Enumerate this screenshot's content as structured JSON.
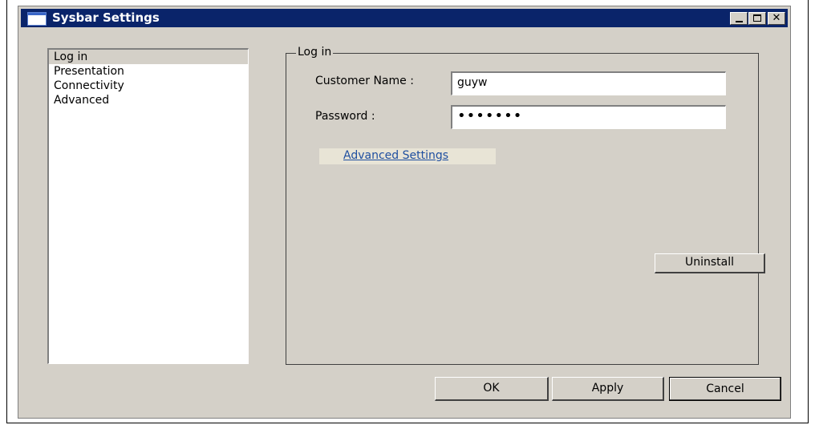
{
  "window": {
    "title": "Sysbar Settings"
  },
  "nav": {
    "items": [
      "Log in",
      "Presentation",
      "Connectivity",
      "Advanced"
    ],
    "selected": "Log in"
  },
  "login_group": {
    "title": "Log in",
    "customer_name_label": "Customer Name :",
    "customer_name_value": "guyw",
    "password_label": "Password :",
    "password_value": "•••••••",
    "advanced_link": "Advanced Settings",
    "uninstall_label": "Uninstall"
  },
  "footer": {
    "ok_label": "OK",
    "apply_label": "Apply",
    "cancel_label": "Cancel"
  },
  "colors": {
    "titlebar": "#0a246a",
    "face": "#d4d0c8",
    "link": "#1f4fa0"
  }
}
